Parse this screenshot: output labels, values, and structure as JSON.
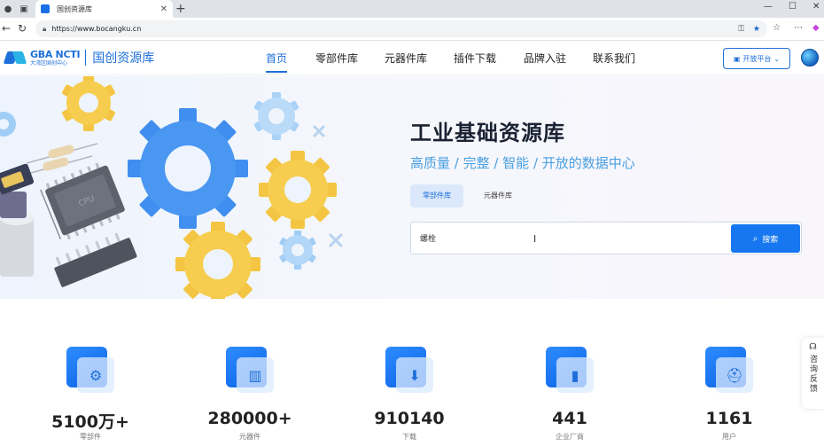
{
  "browser": {
    "tab_title": "国创资源库",
    "url": "https://www.bocangku.cn",
    "icons": [
      "profile-icon",
      "tab-actions-icon",
      "close-icon",
      "new-tab-icon",
      "minimize-icon",
      "maximize-icon",
      "window-close-icon",
      "back-icon",
      "refresh-icon",
      "favorite-star-icon",
      "collections-icon",
      "more-icon",
      "copilot-icon"
    ]
  },
  "header": {
    "logo_gba": "GBA NCTI",
    "logo_sub": "大湾区国创中心",
    "logo_cn": "国创资源库",
    "nav": [
      "首页",
      "零部件库",
      "元器件库",
      "插件下载",
      "品牌入驻",
      "联系我们"
    ],
    "active_nav": 0,
    "open_platform": "开放平台",
    "accent": "#1e6fd9"
  },
  "hero": {
    "title": "工业基础资源库",
    "subtitle": "高质量 / 完整 / 智能 / 开放的数据中心",
    "tabs": [
      "零部件库",
      "元器件库"
    ],
    "active_tab": 0,
    "search_value": "螺栓",
    "search_button": "搜索",
    "chip_label": "CPU"
  },
  "stats": [
    {
      "value": "5100万+",
      "label": "零部件",
      "icon": "gear-icon"
    },
    {
      "value": "280000+",
      "label": "元器件",
      "icon": "chip-icon"
    },
    {
      "value": "910140",
      "label": "下载",
      "icon": "download-icon"
    },
    {
      "value": "441",
      "label": "企业厂商",
      "icon": "building-icon"
    },
    {
      "value": "1161",
      "label": "用户",
      "icon": "user-helmet-icon"
    }
  ],
  "feedback": {
    "label": "咨询反馈"
  }
}
